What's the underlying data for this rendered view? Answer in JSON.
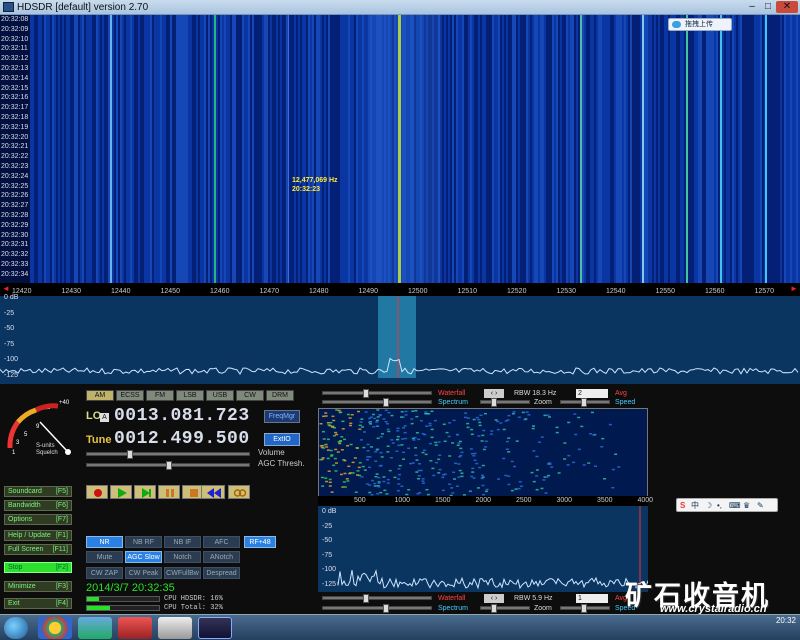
{
  "window": {
    "title": "HDSDR [default]  version 2.70",
    "min_glyph": "–",
    "max_glyph": "□",
    "close_glyph": "✕"
  },
  "waterfall": {
    "timestamps": [
      "20:32:08",
      "20:32:09",
      "20:32:10",
      "20:32:11",
      "20:32:12",
      "20:32:13",
      "20:32:14",
      "20:32:15",
      "20:32:16",
      "20:32:17",
      "20:32:18",
      "20:32:19",
      "20:32:20",
      "20:32:21",
      "20:32:22",
      "20:32:23",
      "20:32:24",
      "20:32:25",
      "20:32:26",
      "20:32:27",
      "20:32:28",
      "20:32:29",
      "20:32:30",
      "20:32:31",
      "20:32:32",
      "20:32:33",
      "20:32:34"
    ],
    "cursor_freq": "12,477,069 Hz",
    "cursor_time": "20:32:23",
    "upload_button": "拖拽上传"
  },
  "freq_axis": {
    "labels": [
      "12420",
      "12430",
      "12440",
      "12450",
      "12460",
      "12470",
      "12480",
      "12490",
      "12500",
      "12510",
      "12520",
      "12530",
      "12540",
      "12550",
      "12560",
      "12570"
    ],
    "left_arrow": "◄",
    "right_arrow": "►"
  },
  "spectrum": {
    "db_labels": [
      "0 dB",
      "-25",
      "-50",
      "-75",
      "-100",
      "-125"
    ]
  },
  "smeter": {
    "scale_top": "+40",
    "scale_9": "9",
    "scale_5": "5",
    "scale_3": "3",
    "scale_1": "1",
    "label_s_units": "S-units",
    "label_squelch": "Squelch"
  },
  "left_buttons": [
    {
      "label": "Soundcard",
      "key": "[F5]"
    },
    {
      "label": "Bandwidth",
      "key": "[F6]"
    },
    {
      "label": "Options",
      "key": "[F7]"
    },
    {
      "label": "Help / Update",
      "key": "[F1]"
    },
    {
      "label": "Full Screen",
      "key": "[F11]"
    },
    {
      "label": "Stop",
      "key": "[F2]"
    },
    {
      "label": "Minimize",
      "key": "[F3]"
    },
    {
      "label": "Exit",
      "key": "[F4]"
    }
  ],
  "modes": [
    "AM",
    "ECSS",
    "FM",
    "LSB",
    "USB",
    "CW",
    "DRM"
  ],
  "lo": {
    "label": "LO",
    "a": "A",
    "value": "0013.081.723"
  },
  "tune": {
    "label": "Tune",
    "value": "0012.499.500"
  },
  "freqmgr_label": "FreqMgr",
  "extio_label": "ExtIO",
  "volume_label": "Volume",
  "agc_label": "AGC Thresh.",
  "volume_level": 0.25,
  "agc_level": 0.5,
  "filters_row1": [
    "NR",
    "NB RF",
    "NB IF",
    "AFC",
    "RF+48"
  ],
  "filters_row2": [
    "Mute",
    "AGC Slow",
    "Notch",
    "ANotch"
  ],
  "filters_row3": [
    "CW ZAP",
    "CW Peak",
    "CWFullBw",
    "Despread"
  ],
  "datetime": "2014/3/7 20:32:35",
  "cpu": {
    "hdsdr_label": "CPU HDSDR:",
    "hdsdr_value": "16%",
    "total_label": "CPU Total:",
    "total_value": "32%",
    "hdsdr_level": 0.16,
    "total_level": 0.32
  },
  "zoom_controls_top": {
    "waterfall": "Waterfall",
    "spectrum": "Spectrum",
    "rbw": "RBW 18.3 Hz",
    "zoom": "Zoom",
    "avg_val": "2",
    "avg": "Avg",
    "speed": "Speed"
  },
  "zoom_controls_bottom": {
    "waterfall": "Waterfall",
    "spectrum": "Spectrum",
    "rbw": "RBW  5.9 Hz",
    "zoom": "Zoom",
    "avg_val": "1",
    "avg": "Avg",
    "speed": "Speed"
  },
  "zoom_axis": [
    "500",
    "1000",
    "1500",
    "2000",
    "2500",
    "3000",
    "3500",
    "4000"
  ],
  "zoom_db": [
    "0 dB",
    "-25",
    "-50",
    "-75",
    "-100",
    "-125"
  ],
  "ime_bar": {
    "s": "S",
    "zh": "中",
    "moon": "☽",
    "dot": "•,",
    "kbd": "⌨",
    "shirt": "♛",
    "wrench": "✎"
  },
  "watermark": {
    "text": "矿石收音机",
    "url": "www.crystalradio.cn"
  },
  "tray": {
    "time": "20:32"
  },
  "colors": {
    "accent_green": "#29e029",
    "accent_blue": "#2b80e6",
    "wf_bg": "#001a50"
  }
}
